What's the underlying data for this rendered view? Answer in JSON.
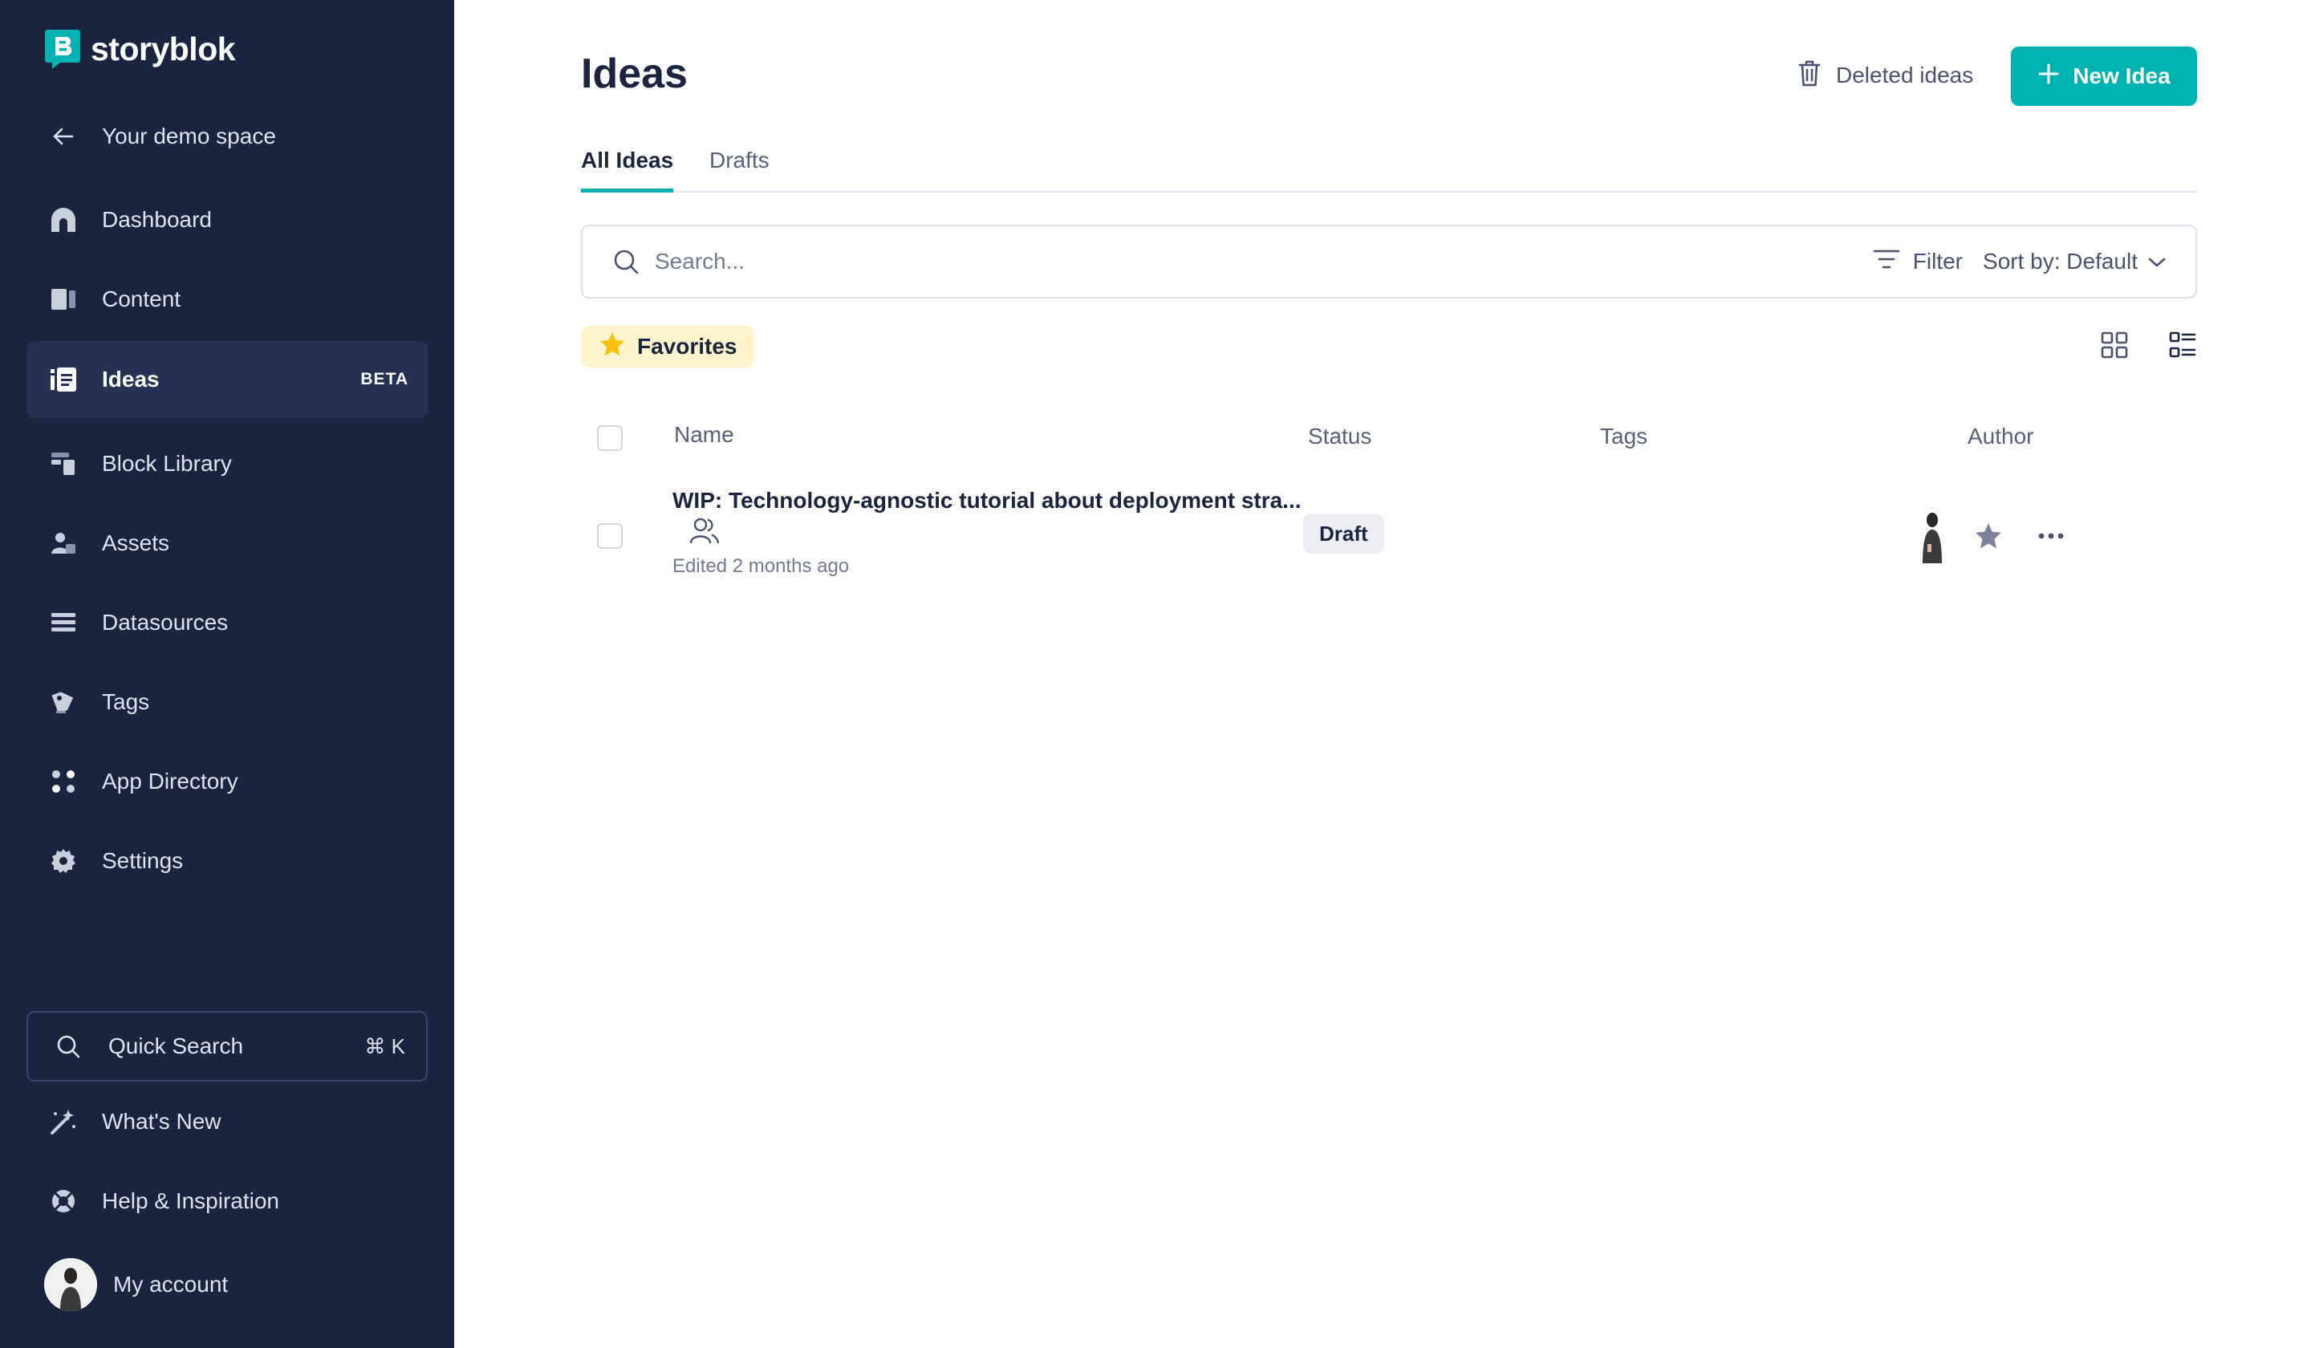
{
  "app": {
    "brand": "storyblok",
    "accent_color": "#00b3b0",
    "sidebar_color": "#1b243f"
  },
  "sidebar": {
    "back_label": "Your demo space",
    "items": [
      {
        "label": "Dashboard",
        "icon": "dashboard-icon"
      },
      {
        "label": "Content",
        "icon": "content-icon"
      },
      {
        "label": "Ideas",
        "icon": "ideas-icon",
        "badge": "BETA",
        "active": true
      },
      {
        "label": "Block Library",
        "icon": "block-library-icon"
      },
      {
        "label": "Assets",
        "icon": "assets-icon"
      },
      {
        "label": "Datasources",
        "icon": "datasources-icon"
      },
      {
        "label": "Tags",
        "icon": "tags-icon"
      },
      {
        "label": "App Directory",
        "icon": "app-directory-icon"
      },
      {
        "label": "Settings",
        "icon": "gear-icon"
      }
    ],
    "quick_search": {
      "label": "Quick Search",
      "shortcut": "⌘ K"
    },
    "whats_new": "What's New",
    "help": "Help & Inspiration",
    "account": "My account"
  },
  "header": {
    "title": "Ideas",
    "deleted_label": "Deleted ideas",
    "new_label": "New Idea"
  },
  "tabs": [
    {
      "label": "All Ideas",
      "active": true
    },
    {
      "label": "Drafts",
      "active": false
    }
  ],
  "search": {
    "placeholder": "Search...",
    "filter_label": "Filter",
    "sort_label": "Sort by: Default"
  },
  "favorites_label": "Favorites",
  "table": {
    "columns": [
      "Name",
      "Status",
      "Tags",
      "Author"
    ],
    "rows": [
      {
        "name": "WIP: Technology-agnostic tutorial about deployment stra...",
        "edited": "Edited 2 months ago",
        "status": "Draft",
        "tags": ""
      }
    ]
  }
}
